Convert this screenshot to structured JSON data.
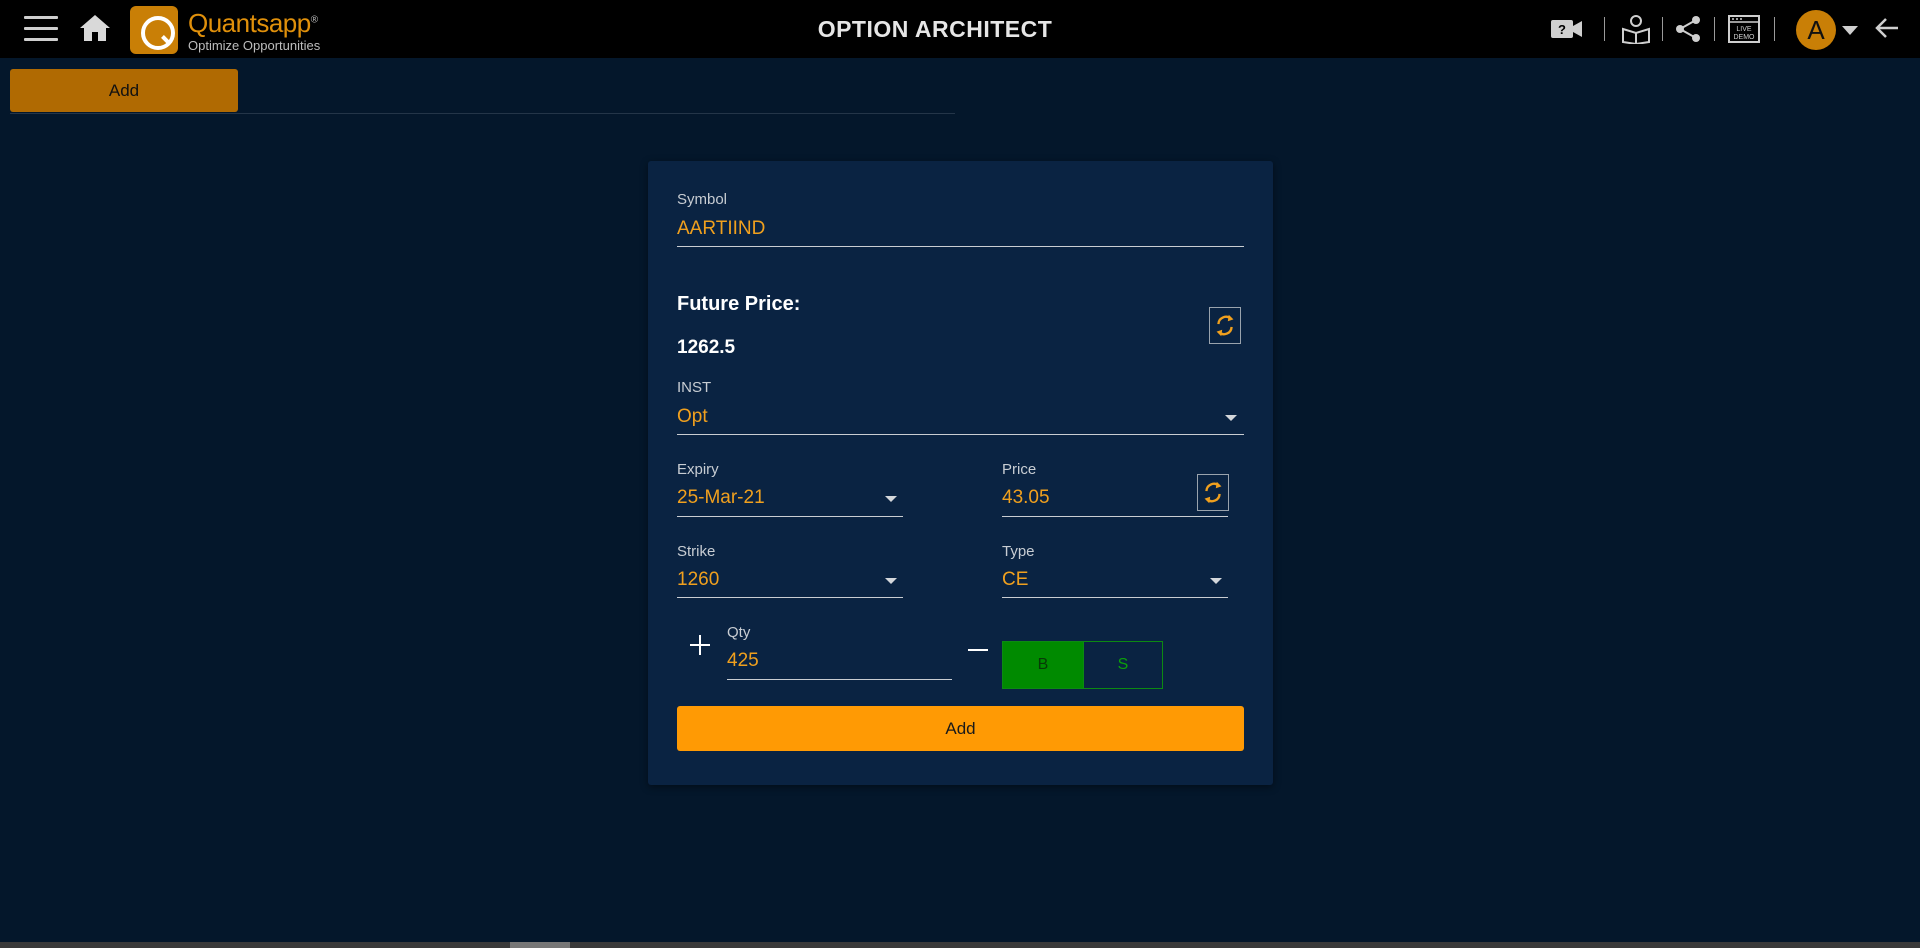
{
  "header": {
    "title": "OPTION ARCHITECT",
    "logo_name": "Quantsapp",
    "logo_reg": "®",
    "logo_tagline": "Optimize Opportunities",
    "avatar_letter": "A",
    "icons": [
      "menu-icon",
      "home-icon",
      "video-help-icon",
      "tutorial-icon",
      "share-icon",
      "live-demo-icon",
      "back-arrow-icon"
    ],
    "live_demo_text": [
      "LIVE",
      "DEMO"
    ]
  },
  "tabs": {
    "add_label": "Add"
  },
  "form": {
    "symbol": {
      "label": "Symbol",
      "value": "AARTIIND"
    },
    "future_price": {
      "label": "Future Price:",
      "value": "1262.5"
    },
    "inst": {
      "label": "INST",
      "value": "Opt"
    },
    "expiry": {
      "label": "Expiry",
      "value": "25-Mar-21"
    },
    "price": {
      "label": "Price",
      "value": "43.05"
    },
    "strike": {
      "label": "Strike",
      "value": "1260"
    },
    "type": {
      "label": "Type",
      "value": "CE"
    },
    "qty": {
      "label": "Qty",
      "value": "425"
    },
    "buy_label": "B",
    "sell_label": "S",
    "selected_side": "B",
    "add_label": "Add"
  },
  "colors": {
    "background": "#04172b",
    "card": "#0a2342",
    "accent": "#ff9a04",
    "value_text": "#f0a01e",
    "buy_green": "#008a00"
  }
}
